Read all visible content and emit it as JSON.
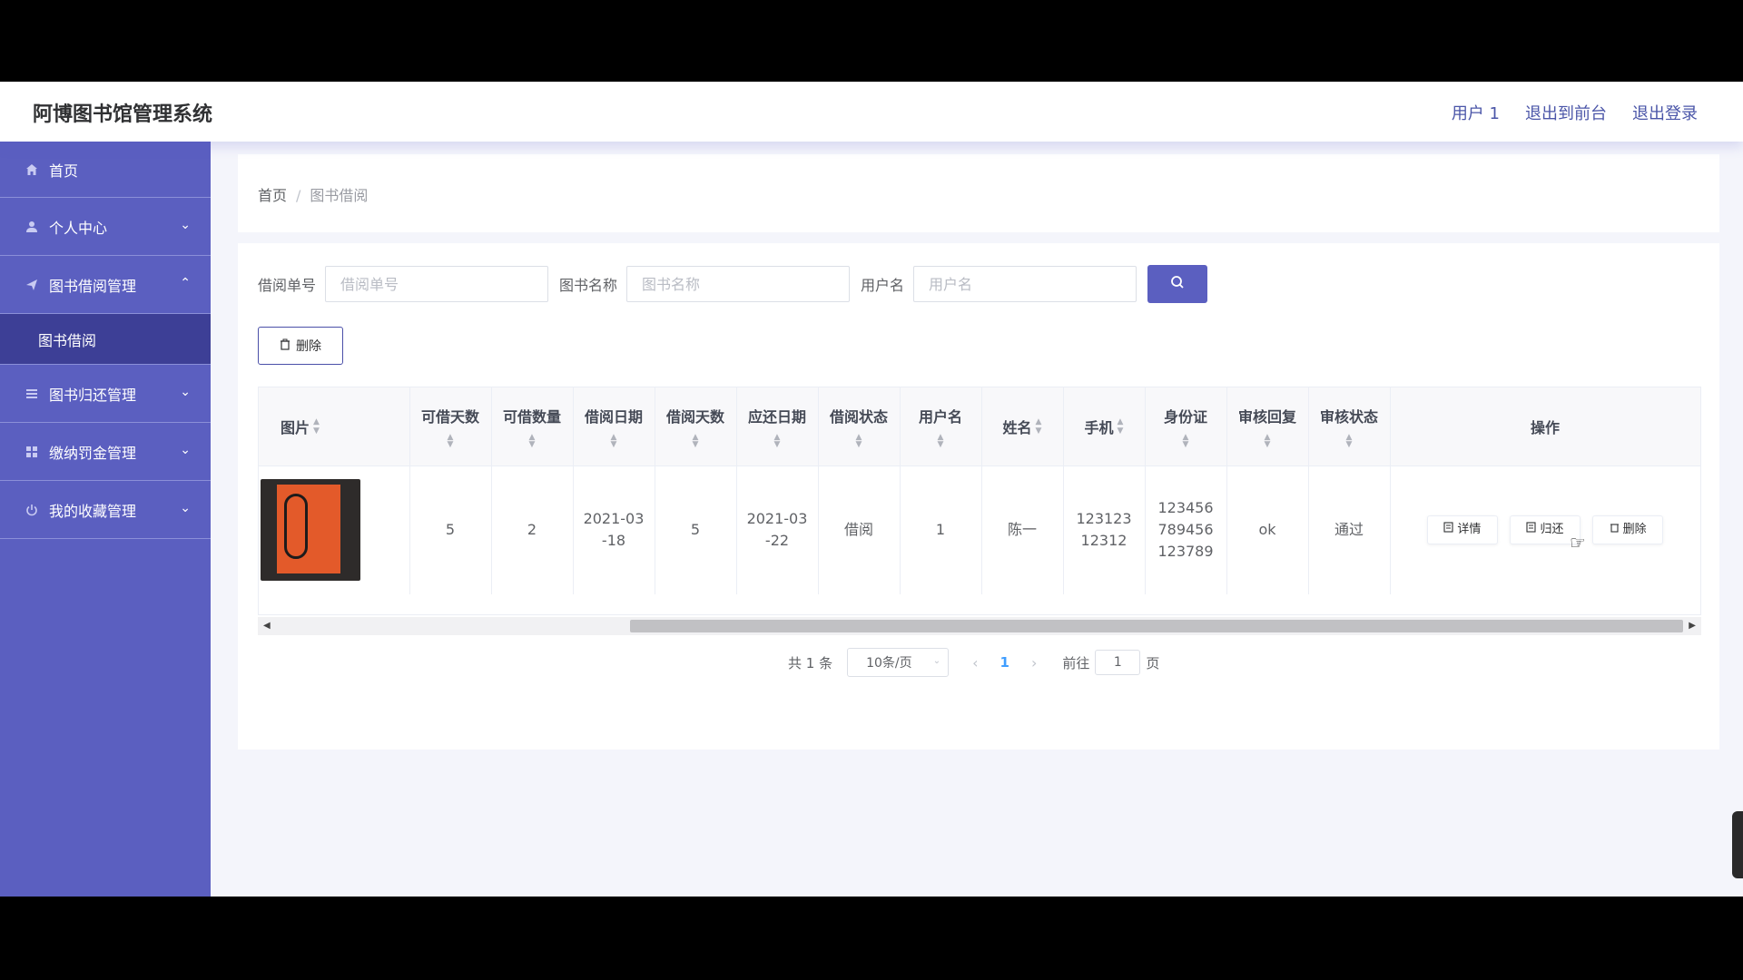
{
  "app": {
    "title": "阿博图书馆管理系统"
  },
  "topnav": {
    "user": "用户 1",
    "to_front": "退出到前台",
    "logout": "退出登录"
  },
  "sidebar": {
    "items": [
      {
        "label": "首页",
        "icon": "home-icon"
      },
      {
        "label": "个人中心",
        "icon": "user-icon",
        "chevron": "down"
      },
      {
        "label": "图书借阅管理",
        "icon": "send-icon",
        "chevron": "up"
      },
      {
        "label": "图书归还管理",
        "icon": "list-icon",
        "chevron": "down"
      },
      {
        "label": "缴纳罚金管理",
        "icon": "grid-icon",
        "chevron": "down"
      },
      {
        "label": "我的收藏管理",
        "icon": "power-icon",
        "chevron": "down"
      }
    ],
    "submenu": {
      "label": "图书借阅"
    }
  },
  "breadcrumb": {
    "home": "首页",
    "separator": "/",
    "current": "图书借阅"
  },
  "search": {
    "borrow_no_label": "借阅单号",
    "borrow_no_placeholder": "借阅单号",
    "book_name_label": "图书名称",
    "book_name_placeholder": "图书名称",
    "username_label": "用户名",
    "username_placeholder": "用户名"
  },
  "toolbar": {
    "delete_label": "删除"
  },
  "table": {
    "headers": {
      "image": "图片",
      "borrow_days_allowed": "可借天数",
      "borrow_qty": "可借数量",
      "borrow_date": "借阅日期",
      "borrow_days": "借阅天数",
      "return_date": "应还日期",
      "borrow_status": "借阅状态",
      "username": "用户名",
      "name": "姓名",
      "phone": "手机",
      "id_card": "身份证",
      "review_reply": "审核回复",
      "review_status": "审核状态",
      "actions": "操作"
    },
    "rows": [
      {
        "borrow_days_allowed": "5",
        "borrow_qty": "2",
        "borrow_date": "2021-03-18",
        "borrow_days": "5",
        "return_date": "2021-03-22",
        "borrow_status": "借阅",
        "username": "1",
        "name": "陈一",
        "phone": "12312312312",
        "id_card": "123456789456123789",
        "review_reply": "ok",
        "review_status": "通过",
        "actions": {
          "detail": "详情",
          "return": "归还",
          "delete": "删除"
        }
      }
    ]
  },
  "pagination": {
    "total": "共 1 条",
    "page_size": "10条/页",
    "current_page": "1",
    "goto_label": "前往",
    "goto_value": "1",
    "page_suffix": "页"
  },
  "colors": {
    "sidebar": "#5b5fc0",
    "submenu_active": "#3d3f96",
    "accent": "#5b5fc0"
  }
}
